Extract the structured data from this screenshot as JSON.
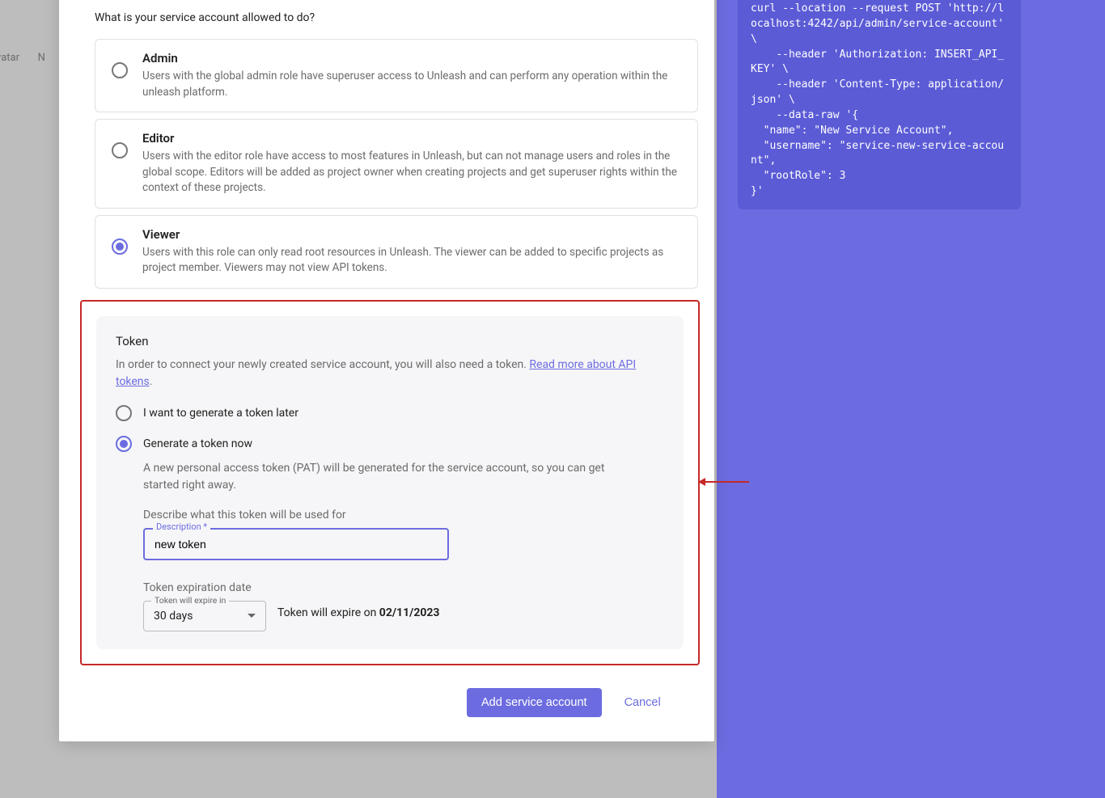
{
  "bg": {
    "avatar": "vatar",
    "n": "N"
  },
  "question": "What is your service account allowed to do?",
  "roles": [
    {
      "title": "Admin",
      "desc": "Users with the global admin role have superuser access to Unleash and can perform any operation within the unleash platform."
    },
    {
      "title": "Editor",
      "desc": "Users with the editor role have access to most features in Unleash, but can not manage users and roles in the global scope. Editors will be added as project owner when creating projects and get superuser rights within the context of these projects."
    },
    {
      "title": "Viewer",
      "desc": "Users with this role can only read root resources in Unleash. The viewer can be added to specific projects as project member. Viewers may not view API tokens."
    }
  ],
  "token": {
    "heading": "Token",
    "intro": "In order to connect your newly created service account, you will also need a token. ",
    "link": "Read more about API tokens",
    "period": ".",
    "opt_later": "I want to generate a token later",
    "opt_now": "Generate a token now",
    "subnote": "A new personal access token (PAT) will be generated for the service account, so you can get started right away.",
    "describe_label": "Describe what this token will be used for",
    "desc_floating": "Description *",
    "desc_value": "new token",
    "exp_heading": "Token expiration date",
    "exp_floating": "Token will expire in",
    "exp_value": "30 days",
    "exp_note_prefix": "Token will expire on ",
    "exp_date": "02/11/2023"
  },
  "buttons": {
    "primary": "Add service account",
    "cancel": "Cancel"
  },
  "code": "curl --location --request POST 'http://localhost:4242/api/admin/service-account' \\\n    --header 'Authorization: INSERT_API_KEY' \\\n    --header 'Content-Type: application/json' \\\n    --data-raw '{\n  \"name\": \"New Service Account\",\n  \"username\": \"service-new-service-account\",\n  \"rootRole\": 3\n}'"
}
